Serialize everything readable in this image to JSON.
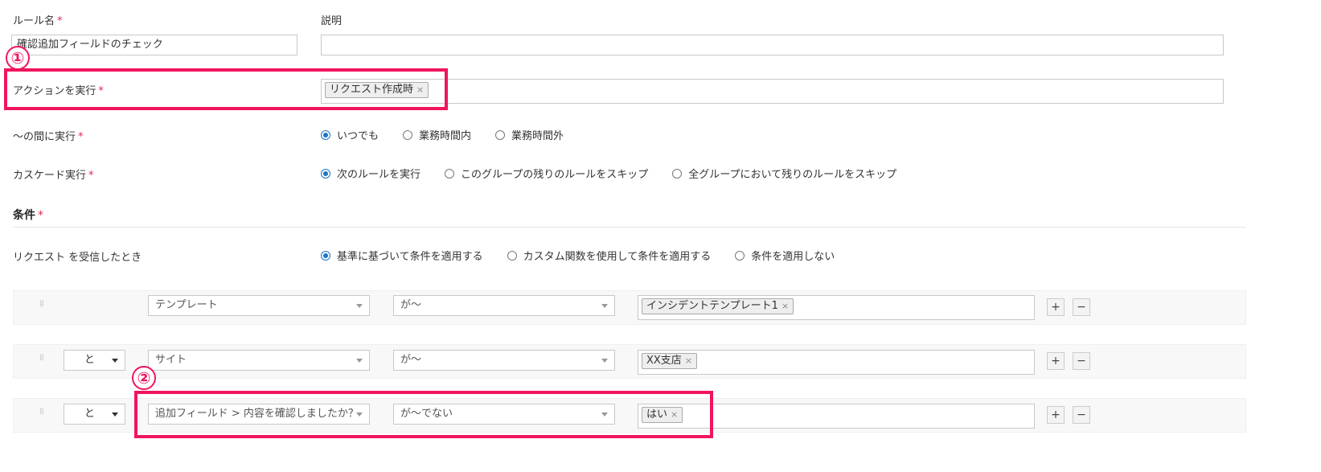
{
  "form": {
    "rule_name": {
      "label": "ルール名",
      "required": "*",
      "value": "確認追加フィールドのチェック"
    },
    "description": {
      "label": "説明",
      "value": ""
    },
    "action": {
      "label": "アクションを実行",
      "required": "*",
      "tag": "リクエスト作成時",
      "remove_icon": "×"
    },
    "execute_during": {
      "label": "〜の間に実行",
      "required": "*",
      "options": [
        {
          "label": "いつでも",
          "selected": true
        },
        {
          "label": "業務時間内",
          "selected": false
        },
        {
          "label": "業務時間外",
          "selected": false
        }
      ]
    },
    "cascade": {
      "label": "カスケード実行",
      "required": "*",
      "options": [
        {
          "label": "次のルールを実行",
          "selected": true
        },
        {
          "label": "このグループの残りのルールをスキップ",
          "selected": false
        },
        {
          "label": "全グループにおいて残りのルールをスキップ",
          "selected": false
        }
      ]
    }
  },
  "conditions": {
    "title": "条件",
    "required": "*",
    "trigger_label": "リクエスト を受信したとき",
    "apply_options": [
      {
        "label": "基準に基づいて条件を適用する",
        "selected": true
      },
      {
        "label": "カスタム関数を使用して条件を適用する",
        "selected": false
      },
      {
        "label": "条件を適用しない",
        "selected": false
      }
    ],
    "rows": [
      {
        "joiner": "",
        "field": "テンプレート",
        "operator": "が〜",
        "value_tag": "インシデントテンプレート1"
      },
      {
        "joiner": "と",
        "field": "サイト",
        "operator": "が〜",
        "value_tag": "XX支店"
      },
      {
        "joiner": "と",
        "field": "追加フィールド > 内容を確認しましたか？",
        "operator": "が〜でない",
        "value_tag": "はい"
      }
    ],
    "add_label": "+",
    "remove_label": "−",
    "grip_glyph": "⁞⁞"
  },
  "callouts": {
    "one": "①",
    "two": "②"
  },
  "colors": {
    "highlight": "#f0155c",
    "radio_selected": "#1a73c7",
    "required": "#e0284f"
  }
}
